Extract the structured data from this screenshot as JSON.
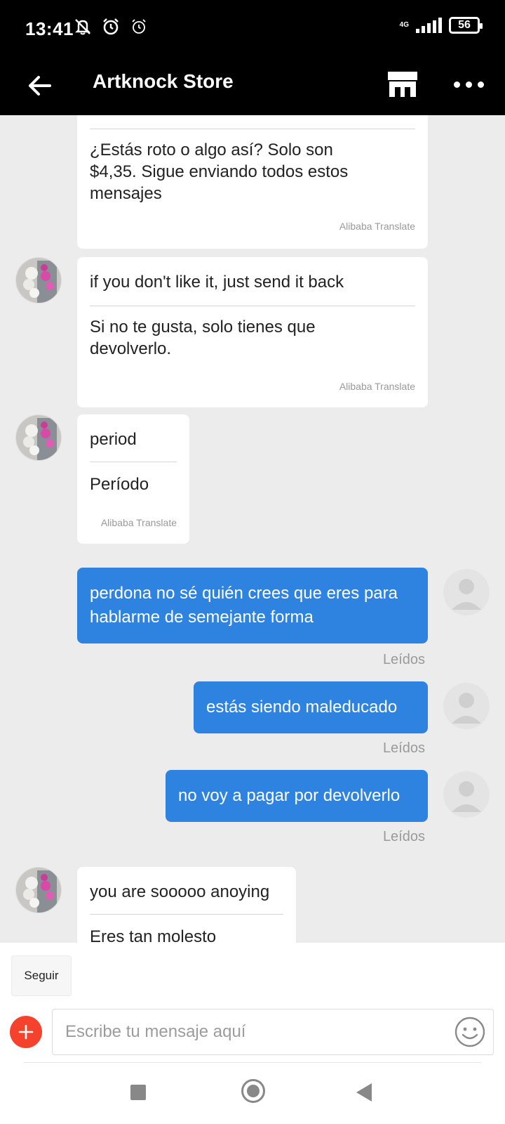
{
  "status_bar": {
    "time": "13:41",
    "network": "4G",
    "battery": "56"
  },
  "header": {
    "title": "Artknock Store"
  },
  "messages": [
    {
      "direction": "in",
      "original": "",
      "translation": "¿Estás roto o algo así? Solo son $4,35. Sigue enviando todos estos mensajes",
      "translate_label": "Alibaba Translate"
    },
    {
      "direction": "in",
      "original": "if you don't like it, just send it back",
      "translation": "Si no te gusta, solo tienes que devolverlo.",
      "translate_label": "Alibaba Translate"
    },
    {
      "direction": "in",
      "original": "period",
      "translation": "Período",
      "translate_label": "Alibaba Translate"
    },
    {
      "direction": "out",
      "text": "perdona no sé quién crees que eres para hablarme de semejante forma",
      "status": "Leídos"
    },
    {
      "direction": "out",
      "text": "estás siendo maleducado",
      "status": "Leídos"
    },
    {
      "direction": "out",
      "text": "no voy a pagar por devolverlo",
      "status": "Leídos"
    },
    {
      "direction": "in",
      "original": "you are sooooo anoying",
      "translation": "Eres tan molesto"
    }
  ],
  "composer": {
    "follow_label": "Seguir",
    "placeholder": "Escribe tu mensaje aquí"
  },
  "colors": {
    "header_bg": "#000000",
    "outgoing_bubble": "#2f83e0",
    "add_button": "#f5422d",
    "chat_bg": "#ececec"
  },
  "icons": {
    "back": "arrow-left-icon",
    "store": "storefront-icon",
    "more": "more-horizontal-icon",
    "add": "plus-icon",
    "emoji": "smiley-icon"
  }
}
